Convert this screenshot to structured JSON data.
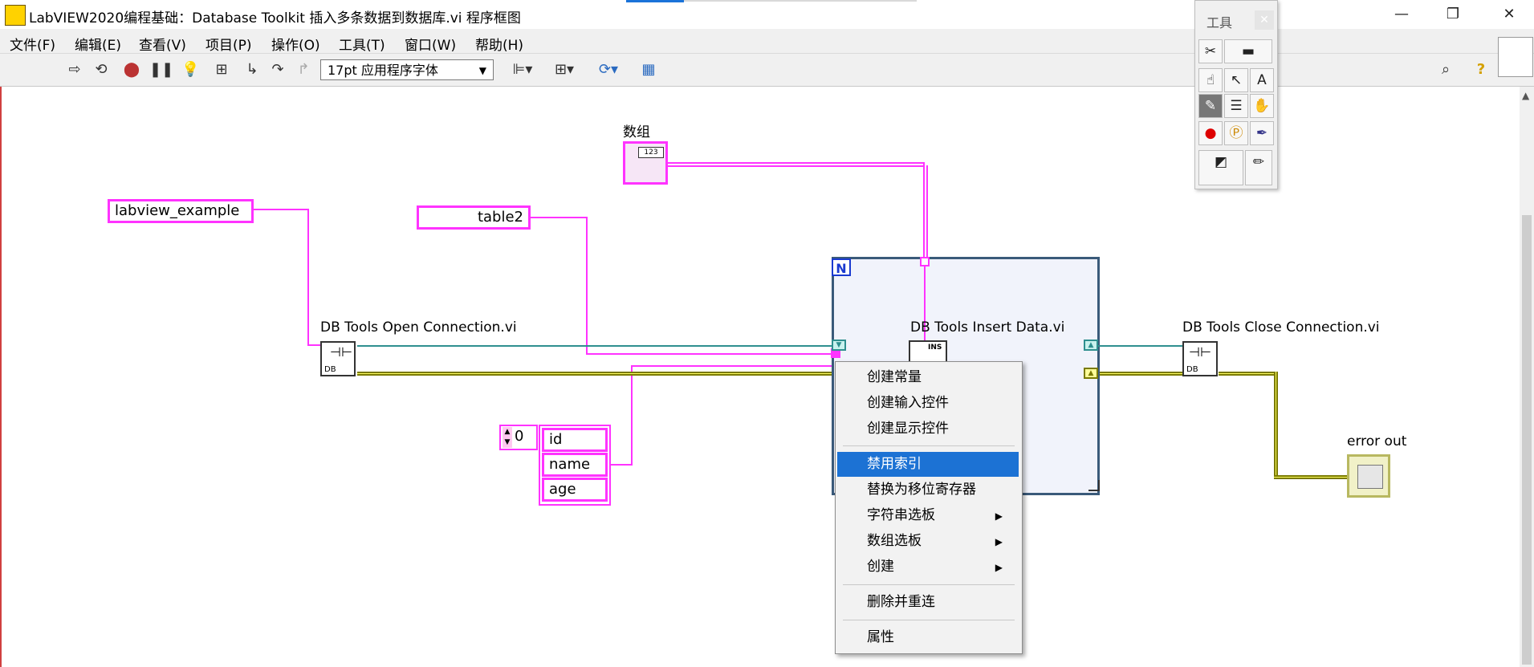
{
  "window": {
    "title": "LabVIEW2020编程基础：Database Toolkit 插入多条数据到数据库.vi 程序框图",
    "minimize": "—",
    "restore": "❐",
    "close": "✕"
  },
  "menu": {
    "items": [
      {
        "label": "文件(F)"
      },
      {
        "label": "编辑(E)"
      },
      {
        "label": "查看(V)"
      },
      {
        "label": "项目(P)"
      },
      {
        "label": "操作(O)"
      },
      {
        "label": "工具(T)"
      },
      {
        "label": "窗口(W)"
      },
      {
        "label": "帮助(H)"
      }
    ]
  },
  "toolbar": {
    "font": "17pt 应用程序字体",
    "icons": [
      "run-arrow-icon",
      "run-continuous-icon",
      "abort-icon",
      "pause-icon",
      "highlight-execution-icon",
      "retain-wire-values-icon",
      "step-into-icon",
      "step-over-icon",
      "step-out-icon",
      "align-objects-icon",
      "distribute-objects-icon",
      "reorder-icon",
      "cleanup-diagram-icon",
      "search-icon",
      "help-icon"
    ]
  },
  "tools_palette": {
    "title": "工具",
    "icons": [
      "auto-tool-icon",
      "pointer-tool-icon",
      "operate-tool-icon",
      "position-tool-icon",
      "text-tool-icon",
      "wiring-tool-icon",
      "shortcut-menu-tool-icon",
      "scroll-tool-icon",
      "breakpoint-tool-icon",
      "probe-tool-icon",
      "color-copy-tool-icon",
      "color-tool-icon"
    ]
  },
  "diagram": {
    "array_label": "数组",
    "array_index": "123",
    "db_name": "labview_example",
    "table_name": "table2",
    "open_vi_label": "DB Tools Open Connection.vi",
    "insert_vi_label": "DB Tools Insert Data.vi",
    "close_vi_label": "DB Tools Close Connection.vi",
    "error_out_label": "error out",
    "loop_n": "N",
    "cluster_index": "0",
    "cluster_fields": [
      "id",
      "name",
      "age"
    ],
    "db_icon_text": "DB",
    "ins_icon_text": "INS"
  },
  "context_menu": {
    "items": [
      {
        "label": "创建常量",
        "submenu": false,
        "selected": false
      },
      {
        "label": "创建输入控件",
        "submenu": false,
        "selected": false
      },
      {
        "label": "创建显示控件",
        "submenu": false,
        "selected": false
      },
      {
        "label": "禁用索引",
        "submenu": false,
        "selected": true
      },
      {
        "label": "替换为移位寄存器",
        "submenu": false,
        "selected": false
      },
      {
        "label": "字符串选板",
        "submenu": true,
        "selected": false
      },
      {
        "label": "数组选板",
        "submenu": true,
        "selected": false
      },
      {
        "label": "创建",
        "submenu": true,
        "selected": false
      },
      {
        "label": "删除并重连",
        "submenu": false,
        "selected": false
      },
      {
        "label": "属性",
        "submenu": false,
        "selected": false
      }
    ]
  },
  "colors": {
    "string_wire": "#ff33ff",
    "refnum_wire": "#2f8f8f",
    "error_wire": "#7a7a00",
    "selection": "#1c72d4"
  }
}
